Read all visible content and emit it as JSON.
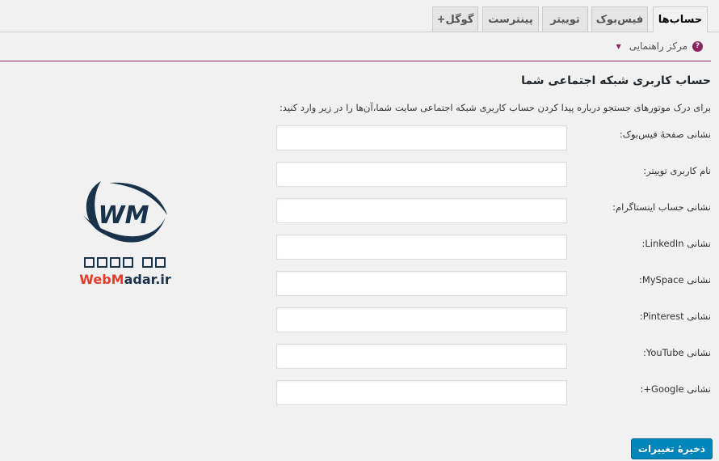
{
  "tabs": [
    {
      "label": "حساب‌ها",
      "active": true
    },
    {
      "label": "فیس‌بوک"
    },
    {
      "label": "توییتر"
    },
    {
      "label": "پینترست"
    },
    {
      "label": "گوگل+"
    }
  ],
  "help": {
    "label": "مرکز راهنمایی",
    "icon": "question-icon"
  },
  "heading": "حساب کاربری شبکه اجتماعی شما",
  "description": "برای درک موتورهای جستجو درباره پیدا کردن حساب کاربری شبکه اجتماعی سایت شما،آن‌ها را در زیر وارد کنید:",
  "fields": [
    {
      "label": "نشانی صفحهٔ فیس‌بوک:",
      "value": ""
    },
    {
      "label": "نام کاربری توییتر:",
      "value": ""
    },
    {
      "label": "نشانی حساب اینستاگرام:",
      "value": ""
    },
    {
      "label": "نشانی LinkedIn:",
      "value": ""
    },
    {
      "label": "نشانی MySpace:",
      "value": ""
    },
    {
      "label": "نشانی Pinterest:",
      "value": ""
    },
    {
      "label": "نشانی YouTube:",
      "value": ""
    },
    {
      "label": "نشانی Google+:",
      "value": ""
    }
  ],
  "logo": {
    "text": "WebMadar.ir",
    "mark": "WM",
    "persian": "وب مادر"
  },
  "save_label": "ذخیرهٔ تغییرات",
  "colors": {
    "accent": "#0085ba",
    "help": "#8a2461",
    "logo_dark": "#17324a",
    "logo_red": "#e53b2c"
  }
}
